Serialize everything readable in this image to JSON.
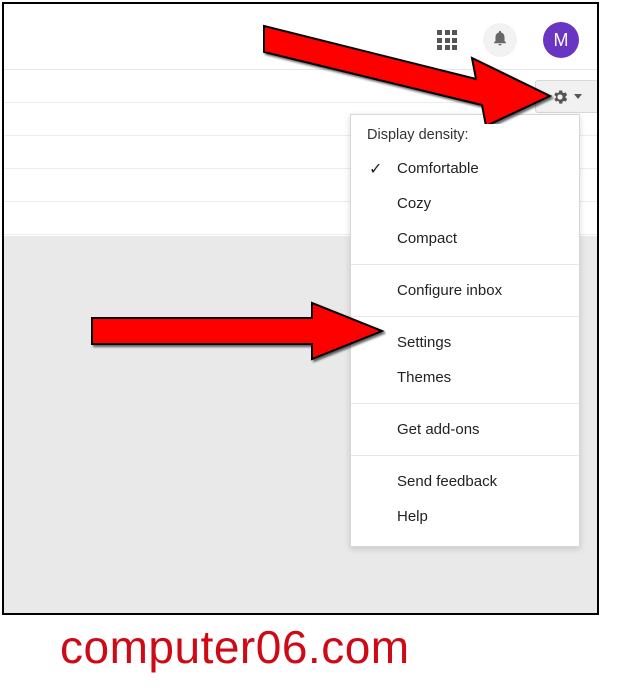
{
  "topbar": {
    "avatar_initial": "M"
  },
  "menu": {
    "header": "Display density:",
    "items": {
      "comfortable": "Comfortable",
      "cozy": "Cozy",
      "compact": "Compact",
      "configure_inbox": "Configure inbox",
      "settings": "Settings",
      "themes": "Themes",
      "addons": "Get add-ons",
      "feedback": "Send feedback",
      "help": "Help"
    },
    "selected": "comfortable"
  },
  "watermark": "computer06.com"
}
